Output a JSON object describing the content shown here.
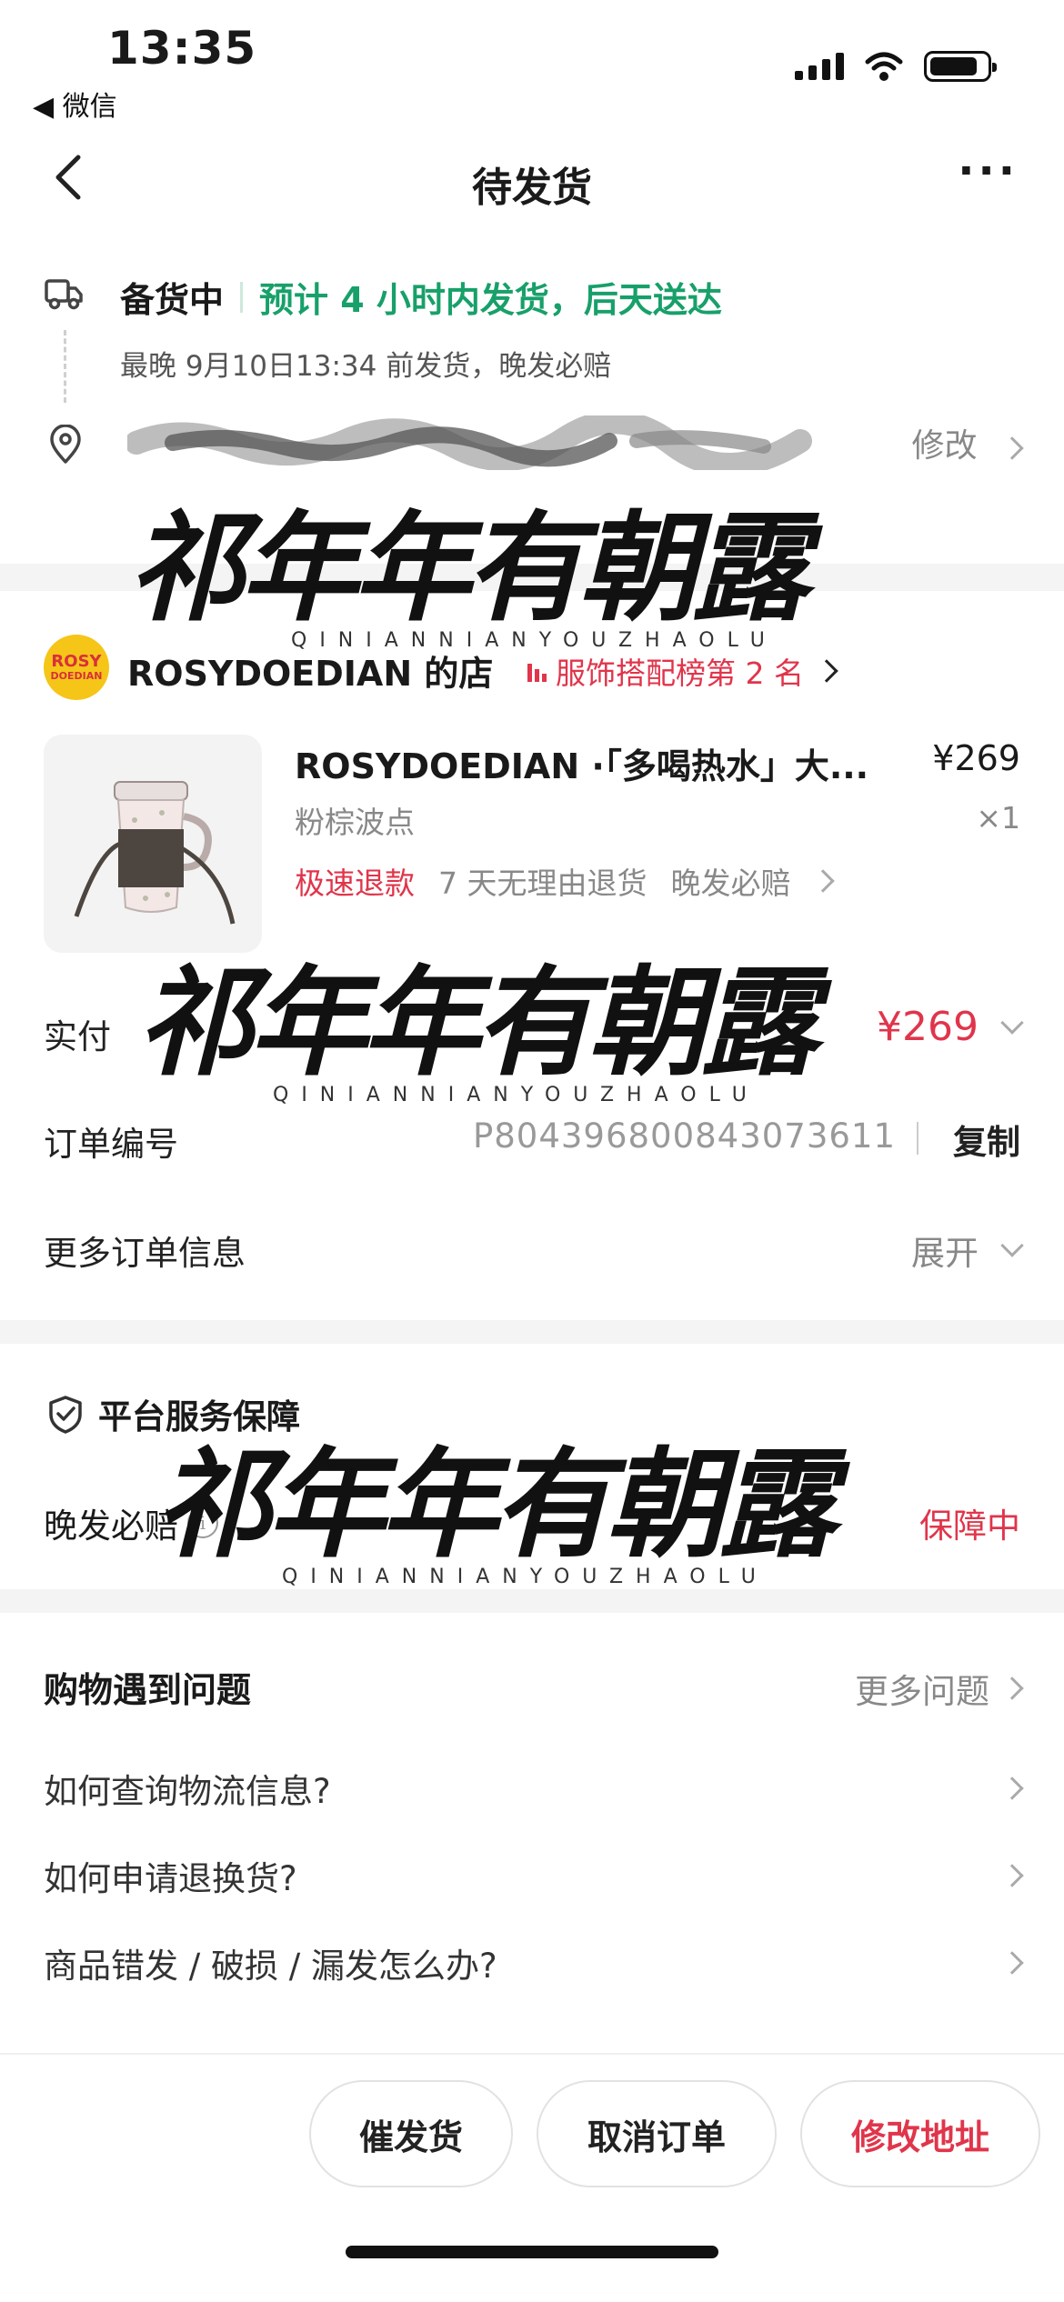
{
  "status_bar": {
    "time": "13:35",
    "back_app": "◀ 微信",
    "battery_level": 0.85,
    "signal_bars": 4
  },
  "header": {
    "title": "待发货",
    "more_icon": "more-horizontal-icon"
  },
  "order_status": {
    "state": "备货中",
    "eta": "预计 4 小时内发货，后天送达",
    "deadline": "最晚 9月10日13:34 前发货，晚发必赔",
    "modify_label": "修改"
  },
  "watermark": {
    "text": "祁年年有朝露",
    "pinyin": "QINIANNIANYOUZHAOLU"
  },
  "shop": {
    "logo_line1": "ROSY",
    "logo_line2": "DOEDIAN",
    "name": "ROSYDOEDIAN 的店",
    "rank": "服饰搭配榜第 2 名"
  },
  "product": {
    "title": "ROSYDOEDIAN ·「多喝热水」大...",
    "price": "¥269",
    "variant": "粉棕波点",
    "qty": "×1",
    "tag_fast_refund": "极速退款",
    "tag_return": "7 天无理由退货",
    "tag_late": "晚发必赔"
  },
  "payment": {
    "label": "实付",
    "amount": "¥269"
  },
  "order_number": {
    "label": "订单编号",
    "value": "P804396800843073611",
    "copy_label": "复制"
  },
  "more_info": {
    "label": "更多订单信息",
    "expand_label": "展开"
  },
  "guarantee": {
    "title": "平台服务保障",
    "item_label": "晚发必赔",
    "item_status": "保障中"
  },
  "faq": {
    "title": "购物遇到问题",
    "more_label": "更多问题",
    "items": [
      "如何查询物流信息?",
      "如何申请退换货?",
      "商品错发 / 破损 / 漏发怎么办?"
    ]
  },
  "bottom_actions": {
    "urge": "催发货",
    "cancel": "取消订单",
    "change_address": "修改地址"
  },
  "colors": {
    "accent_red": "#e0354b",
    "eta_green": "#18a06a",
    "shop_logo_yellow": "#f5c518"
  }
}
